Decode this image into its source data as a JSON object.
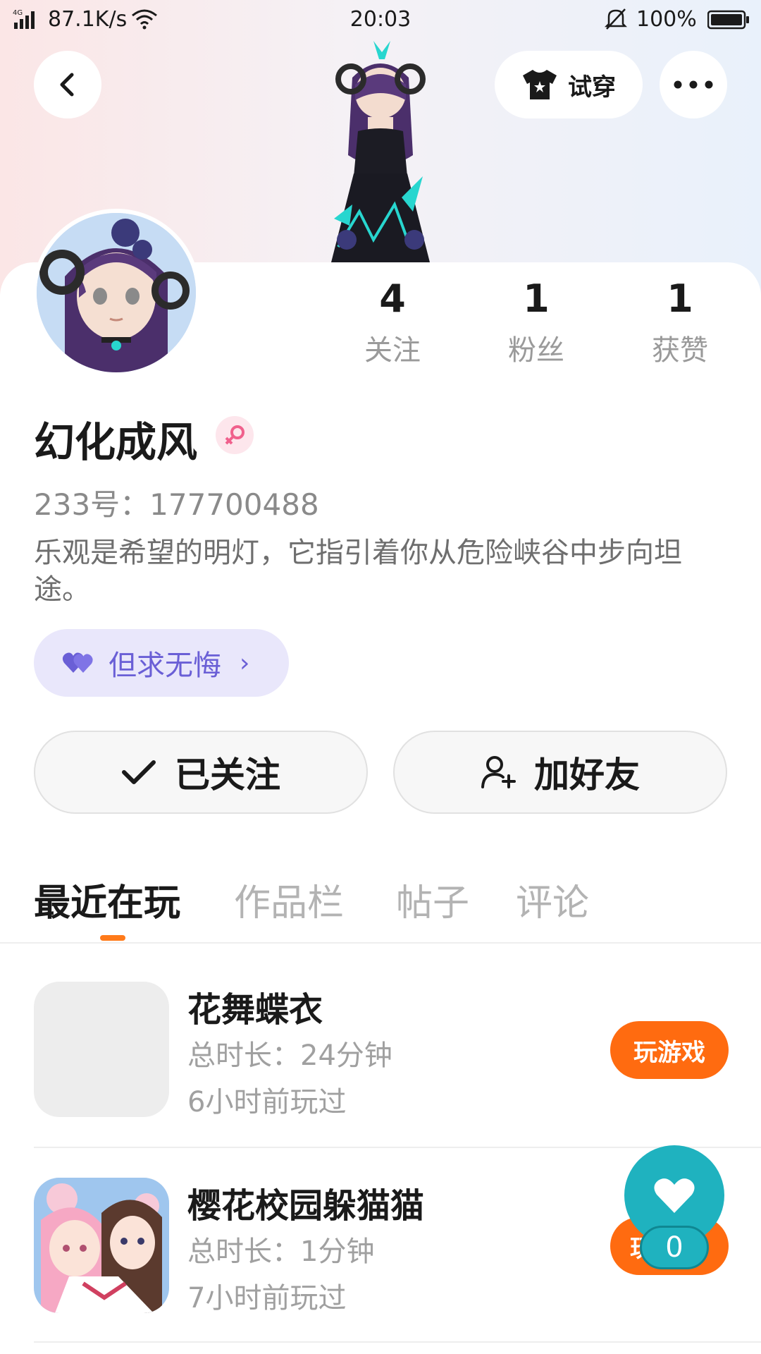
{
  "status_bar": {
    "network_type": "4G",
    "speed": "87.1K/s",
    "time": "20:03",
    "battery": "100%"
  },
  "nav": {
    "tryon_label": "试穿"
  },
  "profile": {
    "stats": [
      {
        "value": "4",
        "label": "关注"
      },
      {
        "value": "1",
        "label": "粉丝"
      },
      {
        "value": "1",
        "label": "获赞"
      }
    ],
    "username": "幻化成风",
    "gender": "female",
    "uid": "233号：177700488",
    "bio": "乐观是希望的明灯，它指引着你从危险峡谷中步向坦途。",
    "tag": "但求无悔"
  },
  "actions": {
    "followed_label": "已关注",
    "add_friend_label": "加好友"
  },
  "tabs": [
    {
      "label": "最近在玩",
      "active": true
    },
    {
      "label": "作品栏",
      "active": false
    },
    {
      "label": "帖子",
      "active": false
    },
    {
      "label": "评论",
      "active": false
    }
  ],
  "games": [
    {
      "title": "花舞蝶衣",
      "duration": "总时长：24分钟",
      "last_played": "6小时前玩过",
      "button": "玩游戏"
    },
    {
      "title": "樱花校园躲猫猫",
      "duration": "总时长：1分钟",
      "last_played": "7小时前玩过",
      "button": "玩"
    }
  ],
  "floating_like": {
    "count": "0"
  },
  "colors": {
    "accent": "#ff6b10",
    "tag_bg": "#e9e7fb",
    "tag_text": "#6a5fd6",
    "like_bg": "#1fb2bf"
  }
}
